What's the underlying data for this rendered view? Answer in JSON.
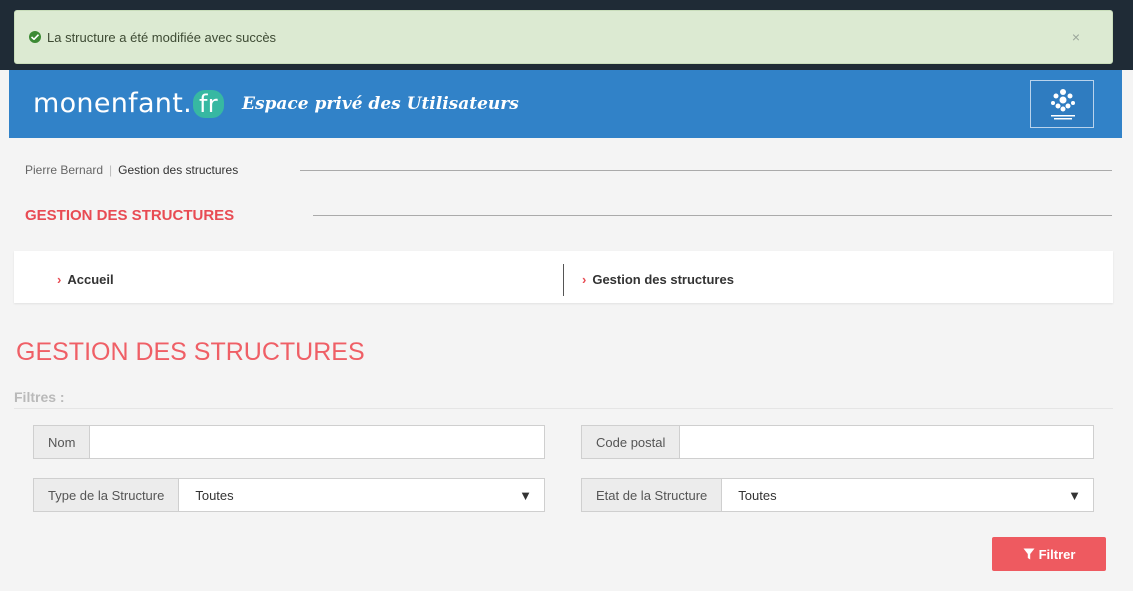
{
  "alert": {
    "message": "La structure a été modifiée avec succès",
    "close_glyph": "×",
    "icon": "check-circle-icon",
    "color": "#dcead2"
  },
  "header": {
    "logo_text": "monenfant.",
    "logo_suffix": "fr",
    "tagline": "Espace privé des Utilisateurs",
    "color": "#3182c8"
  },
  "breadcrumb": {
    "user": "Pierre Bernard",
    "separator": "|",
    "current": "Gestion des structures"
  },
  "section_title": "GESTION DES STRUCTURES",
  "quicknav": {
    "items": [
      {
        "label": "Accueil"
      },
      {
        "label": "Gestion des structures"
      }
    ],
    "chevron": "›"
  },
  "page_heading": "GESTION DES STRUCTURES",
  "filters": {
    "label": "Filtres :",
    "nom": {
      "label": "Nom",
      "value": ""
    },
    "code_postal": {
      "label": "Code postal",
      "value": ""
    },
    "type": {
      "label": "Type de la Structure",
      "selected": "Toutes"
    },
    "etat": {
      "label": "Etat de la Structure",
      "selected": "Toutes"
    },
    "dropdown_arrow": "▼",
    "submit_label": "Filtrer",
    "accent_color": "#ee5a60"
  }
}
